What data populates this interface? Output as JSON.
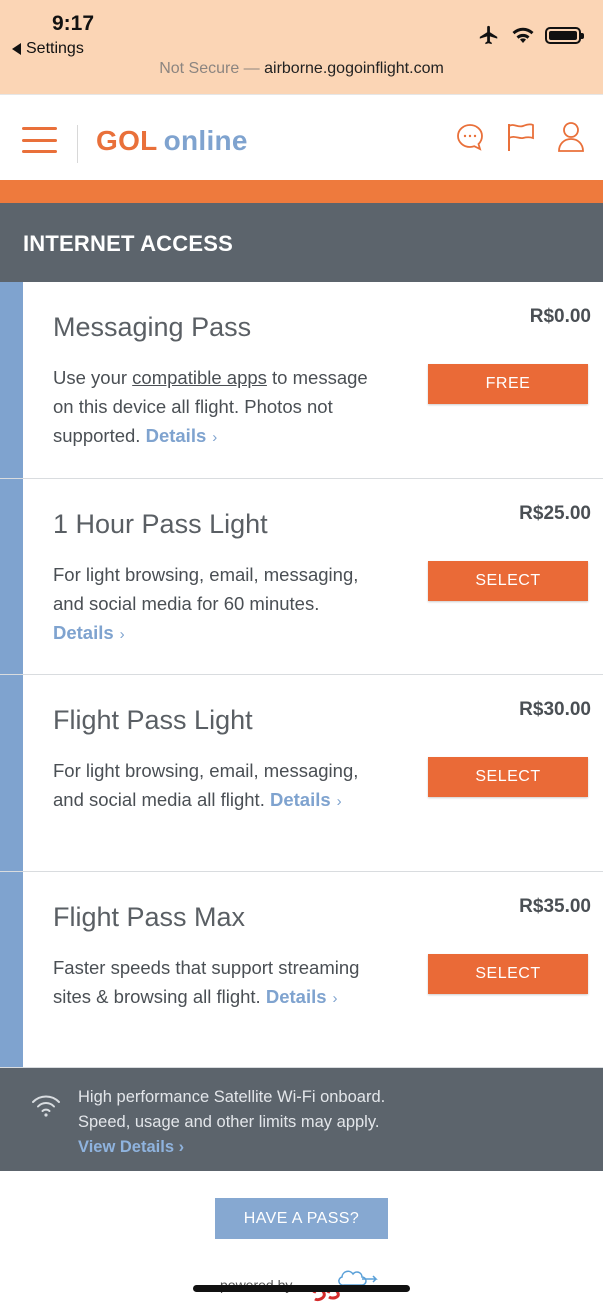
{
  "status_bar": {
    "time": "9:17",
    "back_label": "Settings",
    "icons": [
      "airplane-icon",
      "wifi-icon",
      "battery-icon"
    ]
  },
  "url_bar": {
    "security": "Not Secure —",
    "domain": "airborne.gogoinflight.com"
  },
  "header": {
    "logo_gol": "GOL",
    "logo_online": "online",
    "icons": [
      "menu-icon",
      "chat-icon",
      "flag-icon",
      "user-icon"
    ]
  },
  "section": {
    "title": "INTERNET ACCESS"
  },
  "passes": [
    {
      "name": "Messaging Pass",
      "price": "R$0.00",
      "button": "FREE",
      "desc_pre": "Use your ",
      "desc_link": "compatible apps",
      "desc_post": " to message on this device all flight. Photos not supported. ",
      "details": "Details"
    },
    {
      "name": "1 Hour Pass Light",
      "price": "R$25.00",
      "button": "SELECT",
      "desc": "For light browsing, email, messaging, and social media for 60 minutes. ",
      "details": "Details"
    },
    {
      "name": "Flight Pass Light",
      "price": "R$30.00",
      "button": "SELECT",
      "desc": "For light browsing, email, messaging, and social media all flight. ",
      "details": "Details"
    },
    {
      "name": "Flight Pass Max",
      "price": "R$35.00",
      "button": "SELECT",
      "desc": "Faster speeds that support streaming sites & browsing all flight. ",
      "details": "Details"
    }
  ],
  "info": {
    "line1": "High performance Satellite Wi-Fi onboard.",
    "line2": "Speed, usage and other limits may apply.",
    "link": "View Details ›"
  },
  "footer": {
    "have_pass": "HAVE A PASS?",
    "powered_by": "powered by"
  },
  "colors": {
    "orange": "#ea6a37",
    "blue": "#7fa3cf",
    "slate": "#5c646c"
  }
}
